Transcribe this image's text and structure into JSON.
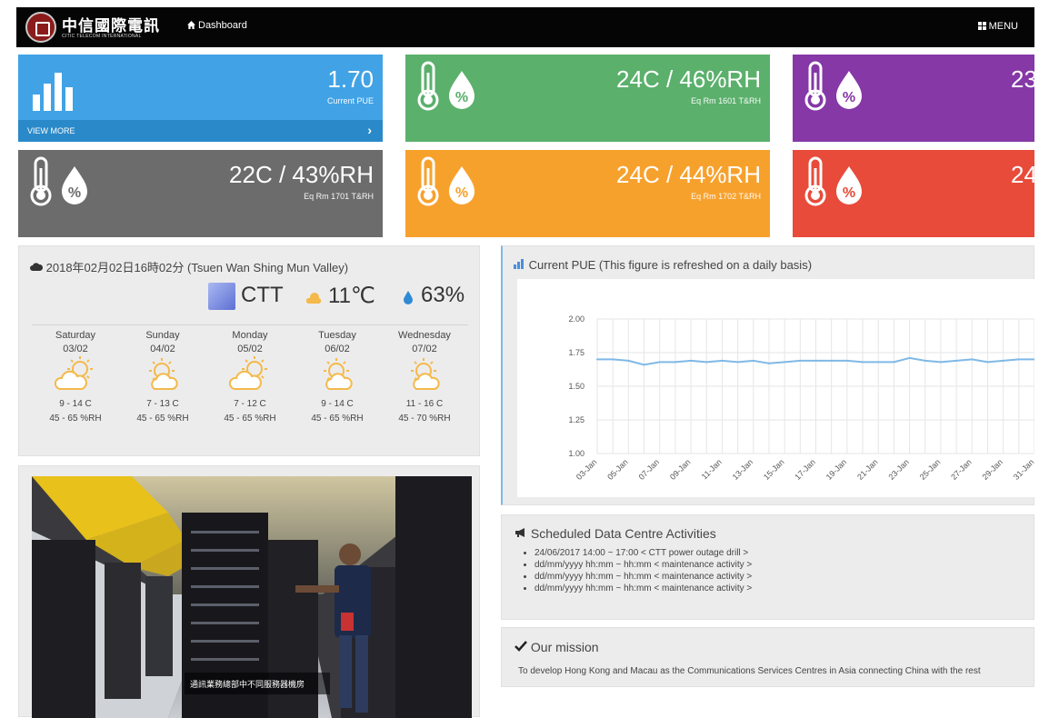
{
  "header": {
    "logo_cn": "中信國際電訊",
    "logo_en": "CITIC TELECOM INTERNATIONAL",
    "nav_dashboard": "Dashboard",
    "nav_menu": "MENU"
  },
  "tiles": [
    {
      "value": "1.70",
      "sub": "Current PUE",
      "footer": "VIEW MORE",
      "color": "#41a3e6"
    },
    {
      "value": "24C / 46%RH",
      "sub": "Eq Rm 1601 T&RH",
      "color": "#5bb06c"
    },
    {
      "value": "23",
      "sub": "",
      "color": "#8538a6"
    },
    {
      "value": "22C / 43%RH",
      "sub": "Eq Rm 1701 T&RH",
      "color": "#6c6c6c"
    },
    {
      "value": "24C / 44%RH",
      "sub": "Eq Rm 1702 T&RH",
      "color": "#f7a12d"
    },
    {
      "value": "24",
      "sub": "",
      "color": "#e84b3a"
    }
  ],
  "weather": {
    "title": "2018年02月02日16時02分 (Tsuen Wan Shing Mun Valley)",
    "station": "CTT",
    "temp": "11℃",
    "humidity": "63%",
    "forecast": [
      {
        "day": "Saturday",
        "date": "03/02",
        "temp": "9 - 14 C",
        "rh": "45 - 65 %RH",
        "icon": "partly-cloudy-sun-icon"
      },
      {
        "day": "Sunday",
        "date": "04/02",
        "temp": "7 - 13 C",
        "rh": "45 - 65 %RH",
        "icon": "sun-cloud-icon"
      },
      {
        "day": "Monday",
        "date": "05/02",
        "temp": "7 - 12 C",
        "rh": "45 - 65 %RH",
        "icon": "partly-cloudy-sun-icon"
      },
      {
        "day": "Tuesday",
        "date": "06/02",
        "temp": "9 - 14 C",
        "rh": "45 - 65 %RH",
        "icon": "sun-cloud-icon"
      },
      {
        "day": "Wednesday",
        "date": "07/02",
        "temp": "11 - 16 C",
        "rh": "45 - 70 %RH",
        "icon": "sun-cloud-icon"
      }
    ]
  },
  "photo": {
    "caption": "通訊業務總部中不同服務器機房"
  },
  "pue_panel": {
    "title": "Current PUE (This figure is refreshed on a daily basis)"
  },
  "chart_data": {
    "type": "line",
    "title": "",
    "xlabel": "",
    "ylabel": "",
    "ylim": [
      1.0,
      2.0
    ],
    "yticks": [
      "2.00",
      "1.75",
      "1.50",
      "1.25",
      "1.00"
    ],
    "x": [
      "03-Jan",
      "04-Jan",
      "05-Jan",
      "06-Jan",
      "07-Jan",
      "08-Jan",
      "09-Jan",
      "10-Jan",
      "11-Jan",
      "12-Jan",
      "13-Jan",
      "14-Jan",
      "15-Jan",
      "16-Jan",
      "17-Jan",
      "18-Jan",
      "19-Jan",
      "20-Jan",
      "21-Jan",
      "22-Jan",
      "23-Jan",
      "24-Jan",
      "25-Jan",
      "26-Jan",
      "27-Jan",
      "28-Jan",
      "29-Jan",
      "30-Jan",
      "31-Jan"
    ],
    "xtick_labels": [
      "03-Jan",
      "05-Jan",
      "07-Jan",
      "09-Jan",
      "11-Jan",
      "13-Jan",
      "15-Jan",
      "17-Jan",
      "19-Jan",
      "21-Jan",
      "23-Jan",
      "25-Jan",
      "27-Jan",
      "29-Jan",
      "31-Jan"
    ],
    "series": [
      {
        "values": [
          1.7,
          1.7,
          1.69,
          1.66,
          1.68,
          1.68,
          1.69,
          1.68,
          1.69,
          1.68,
          1.69,
          1.67,
          1.68,
          1.69,
          1.69,
          1.69,
          1.69,
          1.68,
          1.68,
          1.68,
          1.71,
          1.69,
          1.68,
          1.69,
          1.7,
          1.68,
          1.69,
          1.7,
          1.7
        ],
        "color": "#7fb9e6"
      }
    ],
    "grid": true
  },
  "activities": {
    "title": "Scheduled Data Centre Activities",
    "items": [
      "24/06/2017 14:00 ~ 17:00 < CTT power outage drill >",
      "dd/mm/yyyy hh:mm ~ hh:mm < maintenance activity >",
      "dd/mm/yyyy hh:mm ~ hh:mm < maintenance activity >",
      "dd/mm/yyyy hh:mm ~ hh:mm < maintenance activity >"
    ]
  },
  "mission": {
    "title": "Our mission",
    "text": "To develop Hong Kong and Macau as the Communications Services Centres in Asia connecting China with the rest"
  }
}
